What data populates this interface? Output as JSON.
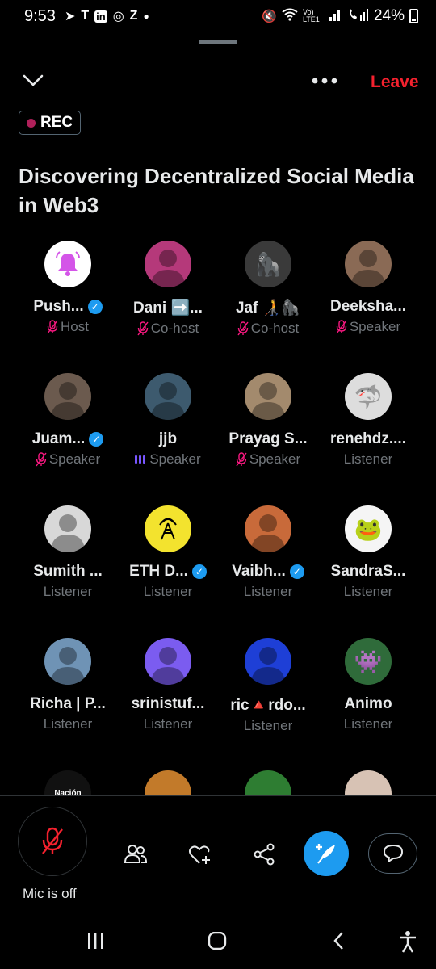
{
  "status_bar": {
    "time": "9:53",
    "notification_icons": [
      "telegram-icon",
      "teams-icon",
      "linkedin-icon",
      "app-icon",
      "z-icon",
      "dot-icon"
    ],
    "network_label": "Vo) LTE1",
    "battery": "24%"
  },
  "header": {
    "leave_label": "Leave",
    "rec_label": "REC",
    "title": "Discovering Decentralized Social Media in Web3"
  },
  "participants": [
    {
      "name": "Push...",
      "role": "Host",
      "verified": true,
      "status": "muted",
      "avatar_color": "#ffffff",
      "avatar_icon": "bell-icon"
    },
    {
      "name": "Dani ➡️...",
      "role": "Co-host",
      "verified": false,
      "status": "muted",
      "avatar_color": "#b5397a",
      "avatar_icon": "person-icon"
    },
    {
      "name": "Jaf 🧑‍🦯🦍",
      "role": "Co-host",
      "verified": false,
      "status": "muted",
      "avatar_color": "#3a3a3a",
      "avatar_icon": "ape-icon"
    },
    {
      "name": "Deeksha...",
      "role": "Speaker",
      "verified": false,
      "status": "muted",
      "avatar_color": "#8a6a55",
      "avatar_icon": "person-icon"
    },
    {
      "name": "Juam...",
      "role": "Speaker",
      "verified": true,
      "status": "muted",
      "avatar_color": "#6b5a4e",
      "avatar_icon": "person-icon"
    },
    {
      "name": "jjb",
      "role": "Speaker",
      "verified": false,
      "status": "talking",
      "avatar_color": "#3d5a6e",
      "avatar_icon": "person-icon"
    },
    {
      "name": "Prayag S...",
      "role": "Speaker",
      "verified": false,
      "status": "muted",
      "avatar_color": "#a38a6d",
      "avatar_icon": "person-icon"
    },
    {
      "name": "renehdz....",
      "role": "Listener",
      "verified": false,
      "status": "none",
      "avatar_color": "#dddddd",
      "avatar_icon": "shark-icon"
    },
    {
      "name": "Sumith ...",
      "role": "Listener",
      "verified": false,
      "status": "none",
      "avatar_color": "#d8d8d8",
      "avatar_icon": "person-icon"
    },
    {
      "name": "ETH D...",
      "role": "Listener",
      "verified": true,
      "status": "none",
      "avatar_color": "#f3e32e",
      "avatar_icon": "tower-icon"
    },
    {
      "name": "Vaibh...",
      "role": "Listener",
      "verified": true,
      "status": "none",
      "avatar_color": "#c86a3a",
      "avatar_icon": "person-icon"
    },
    {
      "name": "SandraS...",
      "role": "Listener",
      "verified": false,
      "status": "none",
      "avatar_color": "#f5f5f5",
      "avatar_icon": "frog-icon"
    },
    {
      "name": "Richa | P...",
      "role": "Listener",
      "verified": false,
      "status": "none",
      "avatar_color": "#6f93b5",
      "avatar_icon": "person-icon"
    },
    {
      "name": "srinistuf...",
      "role": "Listener",
      "verified": false,
      "status": "none",
      "avatar_color": "#7b5cf0",
      "avatar_icon": "person-icon"
    },
    {
      "name": "ric🔺rdo...",
      "role": "Listener",
      "verified": false,
      "status": "none",
      "avatar_color": "#1e3fd6",
      "avatar_icon": "person-icon"
    },
    {
      "name": "Animo",
      "role": "Listener",
      "verified": false,
      "status": "none",
      "avatar_color": "#2f6b3a",
      "avatar_icon": "pixel-person-icon"
    }
  ],
  "partial_row": [
    {
      "avatar_color": "#111111",
      "avatar_text": "Nación"
    },
    {
      "avatar_color": "#c27a2a",
      "avatar_text": ""
    },
    {
      "avatar_color": "#2e7d32",
      "avatar_text": ""
    },
    {
      "avatar_color": "#d7c2b4",
      "avatar_text": ""
    }
  ],
  "bottom_bar": {
    "mic_label": "Mic is off"
  },
  "colors": {
    "accent": "#1d9bf0",
    "danger": "#f4212e",
    "muted_mic": "#f91880",
    "talking": "#7856ff"
  }
}
